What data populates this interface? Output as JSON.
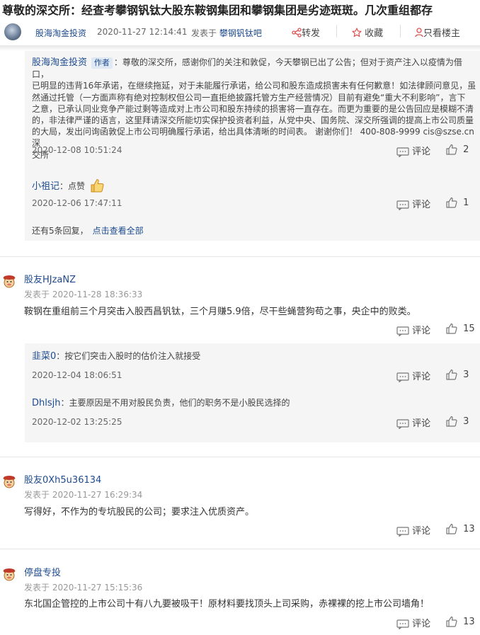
{
  "post": {
    "title": "尊敬的深交所：经查考攀钢钒钛大股东鞍钢集团和攀钢集团是劣迹斑斑。几次重组都存",
    "author": "股海淘金投资",
    "date": "2020-11-27 12:14:41",
    "posted_in_prefix": "发表于",
    "posted_in_board": "攀钢钒钛吧",
    "actions": {
      "share": "转发",
      "collect": "收藏",
      "only_op": "只看楼主"
    }
  },
  "reply_thread_1": {
    "replies": [
      {
        "name": "股海淘金投资",
        "tag": "作者",
        "lines": [
          "：尊敬的深交所，感谢你们的关注和敦促，今天攀钢已出了公告；但对于资产注入以疫情为借口，",
          "已明显的违背16年承诺，在继续拖延，对于未能履行承诺，给公司和股东造成损害未有任何歉意！如法律顾问意见，虽",
          "然通过托管（一方面声称有绝对控制权但公司一直拒绝披露托管方生产经营情况）目前有避免“重大不利影响”，言下",
          "之意，已承认同业竞争产能过剩等造成对上市公司和股东持续的损害将一直存在。而更为重要的是公告回应是模糊不清",
          "的，非法律严谨的语言，这里拜请深交所能切实保护投资者利益，从党中央、国务院、深交所强调的提高上市公司质量",
          "的大局，发出问询函敦促上市公司明确履行承诺，给出具体清晰的时间表。 谢谢你们！ 400-808-9999 cis@szse.cn 深",
          "交所"
        ],
        "time": "2020-12-08 10:51:24",
        "comment_label": "评论",
        "likes": "2"
      },
      {
        "name": "小祖记",
        "text": "：点赞",
        "time": "2020-12-06 17:47:11",
        "comment_label": "评论",
        "likes": "1"
      }
    ],
    "more_text": "还有5条回复，",
    "more_link": "点击查看全部"
  },
  "posts": [
    {
      "name": "股友HJzaNZ",
      "sent": "发表于 2020-11-28 18:36:33",
      "body": "鞍钢在重组前三个月突击入股西昌钒钛，三个月赚5.9倍，尽干些蝇营狗苟之事，央企中的败类。",
      "comment_label": "评论",
      "likes": "15",
      "replies": [
        {
          "name": "韭菜0",
          "text": "：按它们突击入股时的估价注入就接受",
          "time": "2020-12-04 18:06:51",
          "comment_label": "评论",
          "likes": "3"
        },
        {
          "name": "Dhlsjh",
          "text": "：主要原因是不用对股民负责，他们的职务不是小股民选择的",
          "time": "2020-12-02 13:25:25",
          "comment_label": "评论",
          "likes": "3"
        }
      ]
    },
    {
      "name": "股友0Xh5u36134",
      "sent": "发表于 2020-11-27 16:29:34",
      "body": "写得好，不作为的专坑股民的公司；要求注入优质资产。",
      "comment_label": "评论",
      "likes": "13"
    },
    {
      "name": "停盘专投",
      "sent": "发表于 2020-11-27 15:15:36",
      "body": "东北国企管控的上市公司十有八九要被吸干！原材料要找顶头上司采购，赤裸裸的挖上市公司墙角！",
      "comment_label": "评论",
      "likes": "13"
    }
  ],
  "colors": {
    "link": "#1e4b8f",
    "reply_bg": "#f5f5f5",
    "hot_like": "#f4a64a"
  }
}
